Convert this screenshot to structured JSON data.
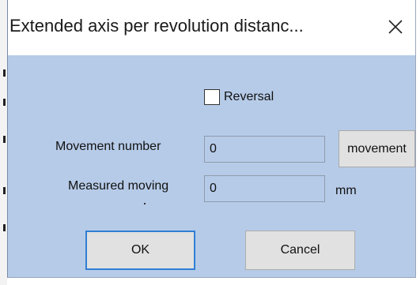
{
  "dialog": {
    "title": "Extended axis per revolution distanc...",
    "close_icon": "close-icon"
  },
  "checkbox": {
    "label": "Reversal",
    "checked": false
  },
  "movement_number": {
    "label": "Movement number",
    "value": "0",
    "button_label": "movement"
  },
  "measured_moving": {
    "label": "Measured moving",
    "value": "0",
    "unit": "mm"
  },
  "buttons": {
    "ok_label": "OK",
    "cancel_label": "Cancel"
  },
  "colors": {
    "dialog_background": "#b6cbe8",
    "button_background": "#e1e1e1",
    "focus_border": "#2f7fd4"
  }
}
